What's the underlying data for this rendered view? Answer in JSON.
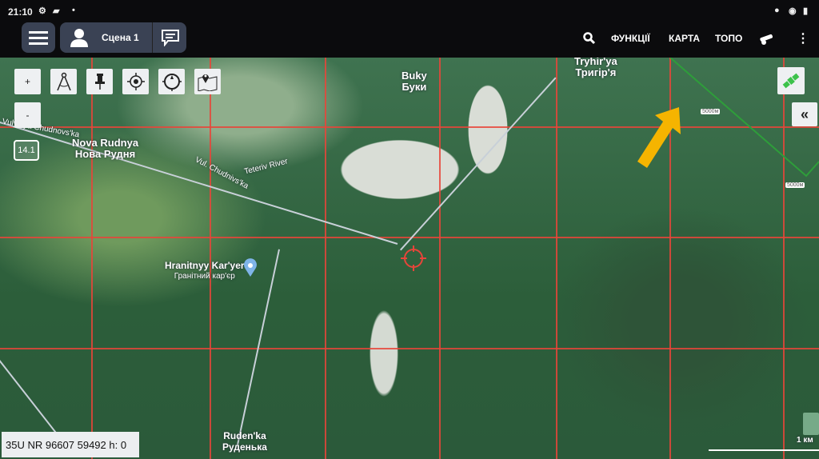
{
  "status_bar": {
    "time": "21:10"
  },
  "toolbar": {
    "scene_label": "Сцена 1",
    "functions": "ФУНКЦІЇ",
    "map": "КАРТА",
    "topo": "ТОПО"
  },
  "map_tools": {
    "zoom_in": "+",
    "zoom_out": "-",
    "zoom_level": "14.1"
  },
  "places": [
    {
      "latin": "Nova Rudnya",
      "cyrillic": "Нова Рудня"
    },
    {
      "latin": "Buky",
      "cyrillic": "Буки"
    },
    {
      "latin": "Tryhir'ya",
      "cyrillic": "Тригір'я"
    },
    {
      "latin": "Hranitnyy Kar'yer",
      "cyrillic": "Гранітний кар'єр"
    },
    {
      "latin": "Ruden'ka",
      "cyrillic": "Руденька"
    }
  ],
  "roads": {
    "road1": "Vulytsya Chudnovs'ka",
    "road2": "Vul. Chudnivs'ka",
    "river": "Teteriv River"
  },
  "grid_labels": [
    "5000м",
    "5000м"
  ],
  "coordinates": "35U NR 96607 59492 h: 0",
  "scale": "1 км",
  "colors": {
    "grid": "#e8453a",
    "arrow": "#f5b400",
    "boundary": "#2e9e3a",
    "toolbar": "#3a4254"
  }
}
